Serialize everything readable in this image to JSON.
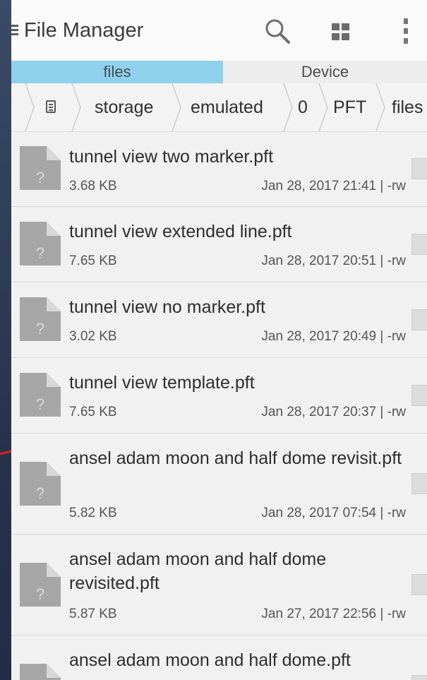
{
  "appbar": {
    "title": "File Manager",
    "icons": {
      "menu": "menu-icon",
      "search": "search-icon",
      "view": "grid-view-icon",
      "more": "more-vert-icon"
    }
  },
  "tabs": [
    {
      "label": "files",
      "active": true
    },
    {
      "label": "Device",
      "active": false
    }
  ],
  "breadcrumb": {
    "root_icon": "storage-device-icon",
    "segments": [
      "storage",
      "emulated",
      "0",
      "PFT",
      "files"
    ]
  },
  "files": [
    {
      "name": "tunnel view two marker.pft",
      "size": "3.68 KB",
      "meta": "Jan 28, 2017 21:41 | -rw"
    },
    {
      "name": "tunnel view extended line.pft",
      "size": "7.65 KB",
      "meta": "Jan 28, 2017 20:51 | -rw"
    },
    {
      "name": "tunnel view no marker.pft",
      "size": "3.02 KB",
      "meta": "Jan 28, 2017 20:49 | -rw"
    },
    {
      "name": "tunnel view template.pft",
      "size": "7.65 KB",
      "meta": "Jan 28, 2017 20:37 | -rw"
    },
    {
      "name": "ansel adam moon and half dome revisit.pft",
      "size": "5.82 KB",
      "meta": "Jan 28, 2017 07:54 | -rw"
    },
    {
      "name": "ansel adam moon and half dome revisited.pft",
      "size": "5.87 KB",
      "meta": "Jan 27, 2017 22:56 | -rw"
    },
    {
      "name": "ansel adam moon and half dome.pft",
      "size": "",
      "meta": ""
    }
  ],
  "colors": {
    "tab_active": "#8fd1ec",
    "annotation_arrow": "#e0211f"
  },
  "file_icon_glyph": "?"
}
